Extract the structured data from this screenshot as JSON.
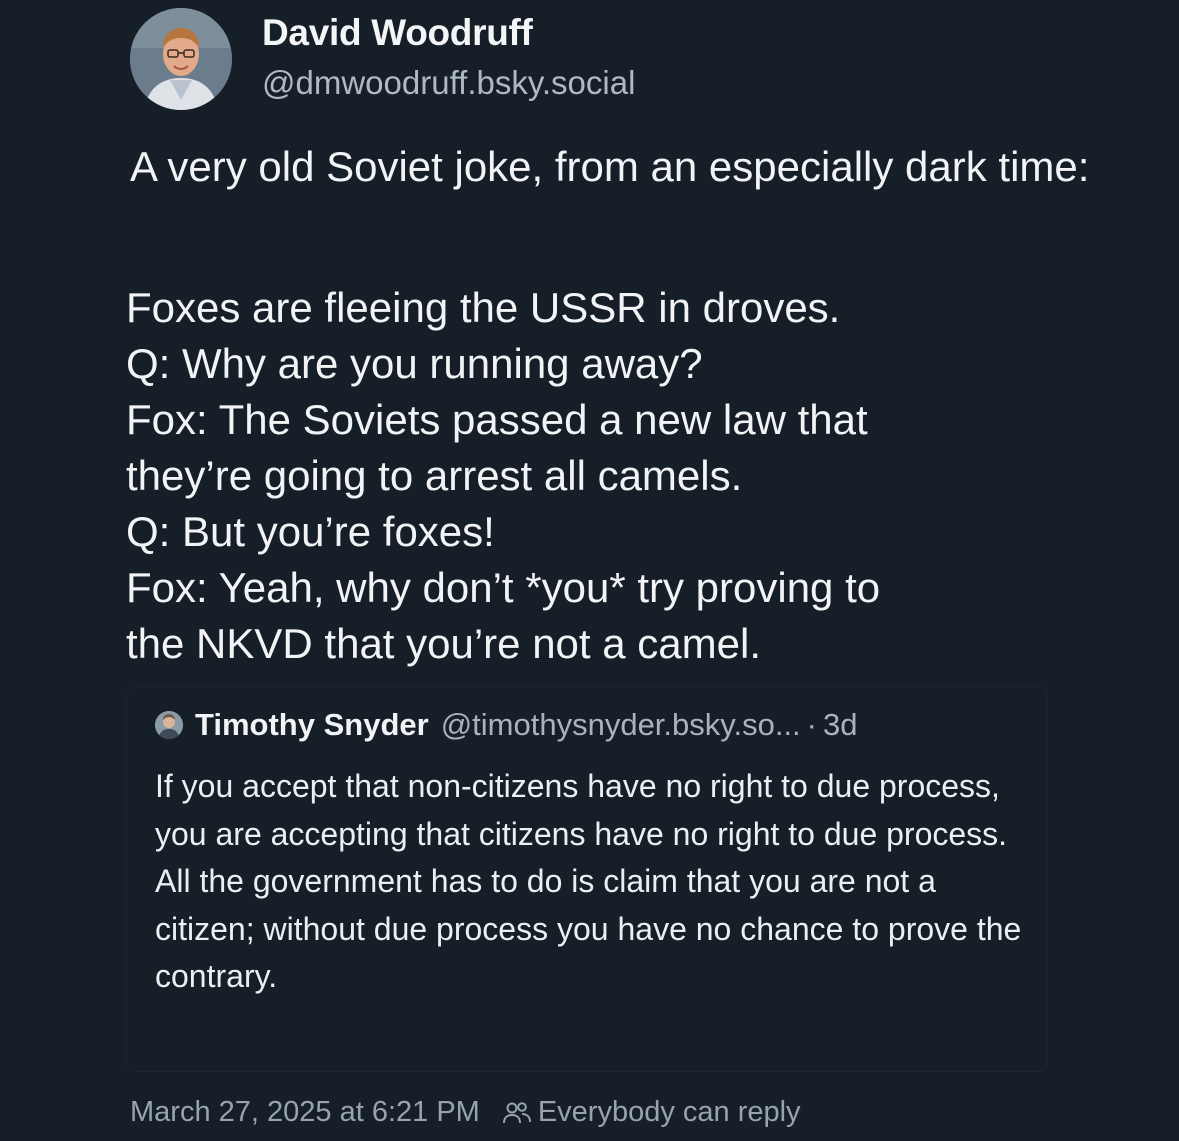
{
  "author": {
    "display_name": "David Woodruff",
    "handle": "@dmwoodruff.bsky.social",
    "avatar_icon": "user-avatar-photo"
  },
  "post": {
    "intro": "A very old Soviet joke, from an especially dark time:",
    "joke_lines": [
      "Foxes are fleeing the USSR in droves.",
      "Q: Why are you running away?",
      "Fox: The Soviets passed a new law that",
      "they’re going to arrest all camels.",
      "Q: But you’re foxes!",
      "Fox: Yeah, why don’t *you* try proving to",
      "the NKVD that you’re not a camel."
    ]
  },
  "quoted_post": {
    "display_name": "Timothy Snyder",
    "handle": "@timothysnyder.bsky.so...",
    "separator": "·",
    "age": "3d",
    "text": "If you accept that non-citizens have no right to due process, you are accepting that citizens have no right to due process. All the government has to do is claim that you are not a citizen; without due process you have no chance to prove the contrary."
  },
  "footer": {
    "timestamp": "March 27, 2025 at 6:21 PM",
    "reply_setting": "Everybody can reply",
    "reply_icon": "people-icon"
  },
  "colors": {
    "background": "#161e27",
    "text_primary": "#f1f3f5",
    "text_secondary": "#a8b3bf"
  }
}
